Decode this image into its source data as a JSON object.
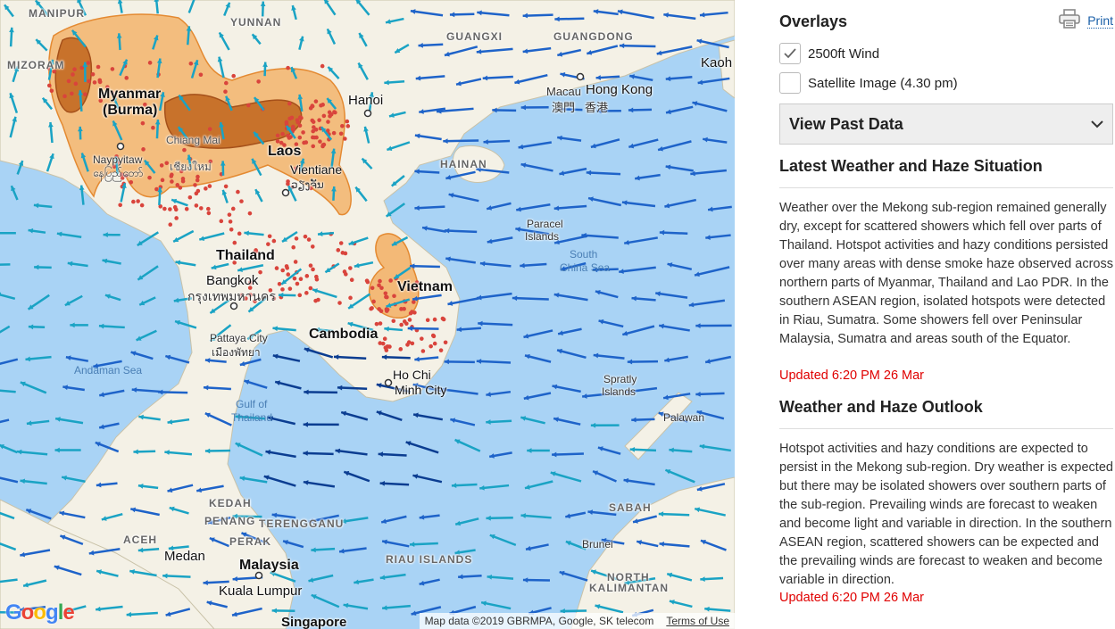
{
  "map": {
    "labels": {
      "manipur": "MANIPUR",
      "mizoram": "MIZORAM",
      "yunnan": "YUNNAN",
      "guangxi": "GUANGXI",
      "guangdong": "GUANGDONG",
      "kaohsiung": "Kaoh",
      "myanmar": "Myanmar",
      "burma": "(Burma)",
      "naypyitaw": "Naypyitaw",
      "naypyitaw_local": "နေပြည်တော်",
      "chiang_mai": "Chiang Mai",
      "chiang_mai_local": "เชียงใหม่",
      "laos": "Laos",
      "vientiane": "Vientiane",
      "vientiane_local": "ວຽງຈັນ",
      "hanoi": "Hanoi",
      "macau": "Macau",
      "macau_local": "澳門",
      "hong_kong": "Hong Kong",
      "hong_kong_local": "香港",
      "hainan": "HAINAN",
      "paracel": "Paracel",
      "paracel2": "Islands",
      "south_china_sea": "South",
      "south_china_sea2": "China Sea",
      "thailand": "Thailand",
      "bangkok": "Bangkok",
      "bangkok_local": "กรุงเทพมหานคร",
      "vietnam": "Vietnam",
      "pattaya": "Pattaya City",
      "pattaya_local": "เมืองพัทยา",
      "cambodia": "Cambodia",
      "andaman_sea": "Andaman Sea",
      "ho_chi_minh": "Ho Chi",
      "ho_chi_minh2": "Minh City",
      "spratly": "Spratly",
      "spratly2": "Islands",
      "gulf": "Gulf of",
      "gulf2": "Thailand",
      "palawan": "Palawan",
      "kedah": "KEDAH",
      "penang": "PENANG",
      "terengganu": "TERENGGANU",
      "aceh": "ACEH",
      "perak": "PERAK",
      "sabah": "SABAH",
      "brunei": "Brunei",
      "riau": "RIAU ISLANDS",
      "medan": "Medan",
      "malaysia": "Malaysia",
      "kuala_lumpur": "Kuala Lumpur",
      "north_kalimantan": "NORTH",
      "north_kalimantan2": "KALIMANTAN",
      "singapore": "Singapore"
    },
    "attribution": "Map data ©2019 GBRMPA, Google, SK telecom",
    "terms": "Terms of Use",
    "logo": "Google",
    "colors": {
      "water": "#a9d3f5",
      "land": "#f4f1e6",
      "haze_light": "#f3ab5b",
      "haze_dense": "#c0651c",
      "hotspot": "#d9443c",
      "arrow_teal": "#1aa3c4",
      "arrow_blue": "#1e63c9",
      "arrow_navy": "#0b3d91"
    }
  },
  "panel": {
    "overlays_title": "Overlays",
    "print_label": "Print",
    "print_icon": "printer-icon",
    "overlays": [
      {
        "label": "2500ft Wind",
        "checked": true
      },
      {
        "label": "Satellite Image (4.30 pm)",
        "checked": false
      }
    ],
    "past_data_label": "View Past Data",
    "latest": {
      "title": "Latest Weather and Haze Situation",
      "body": "Weather over the Mekong sub-region remained generally dry, except for scattered showers which fell over parts of Thailand. Hotspot activities and hazy conditions persisted over many areas with dense smoke haze observed across northern parts of Myanmar, Thailand and Lao PDR. In the southern ASEAN region, isolated hotspots were detected in Riau, Sumatra. Some showers fell over Peninsular Malaysia, Sumatra and areas south of the Equator.",
      "updated": "Updated 6:20 PM 26 Mar"
    },
    "outlook": {
      "title": "Weather and Haze Outlook",
      "body": "Hotspot activities and hazy conditions are expected to persist in the Mekong sub-region. Dry weather is expected but there may be isolated showers over southern parts of the sub-region. Prevailing winds are forecast to weaken and become light and variable in direction. In the southern ASEAN region, scattered showers can be expected and the prevailing winds are forecast to weaken and become variable in direction.",
      "updated": "Updated 6:20 PM 26 Mar"
    }
  }
}
